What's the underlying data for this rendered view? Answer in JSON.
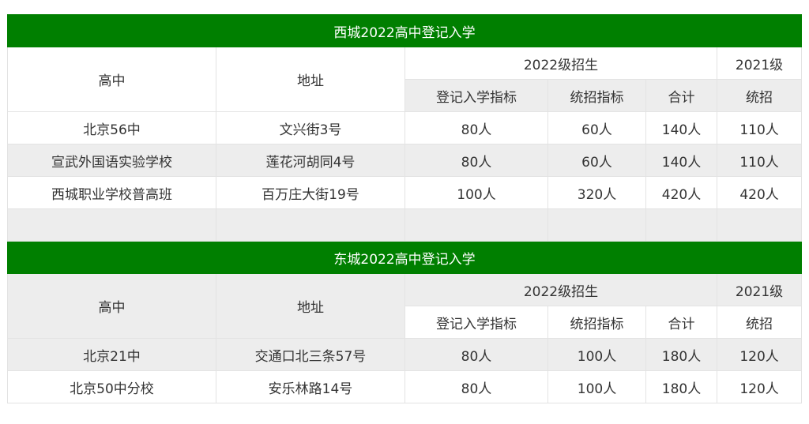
{
  "sections": [
    {
      "title": "西城2022高中登记入学",
      "headers": {
        "school": "高中",
        "address": "地址",
        "group2022": "2022级招生",
        "group2021": "2021级",
        "reg_quota": "登记入学指标",
        "unified_quota": "统招指标",
        "total": "合计",
        "unified_2021": "统招"
      },
      "rows": [
        [
          "北京56中",
          "文兴街3号",
          "80人",
          "60人",
          "140人",
          "110人"
        ],
        [
          "宣武外国语实验学校",
          "莲花河胡同4号",
          "80人",
          "60人",
          "140人",
          "110人"
        ],
        [
          "西城职业学校普高班",
          "百万庄大街19号",
          "100人",
          "320人",
          "420人",
          "420人"
        ]
      ]
    },
    {
      "title": "东城2022高中登记入学",
      "headers": {
        "school": "高中",
        "address": "地址",
        "group2022": "2022级招生",
        "group2021": "2021级",
        "reg_quota": "登记入学指标",
        "unified_quota": "统招指标",
        "total": "合计",
        "unified_2021": "统招"
      },
      "rows": [
        [
          "北京21中",
          "交通口北三条57号",
          "80人",
          "100人",
          "180人",
          "120人"
        ],
        [
          "北京50中分校",
          "安乐林路14号",
          "80人",
          "100人",
          "180人",
          "120人"
        ]
      ]
    }
  ]
}
